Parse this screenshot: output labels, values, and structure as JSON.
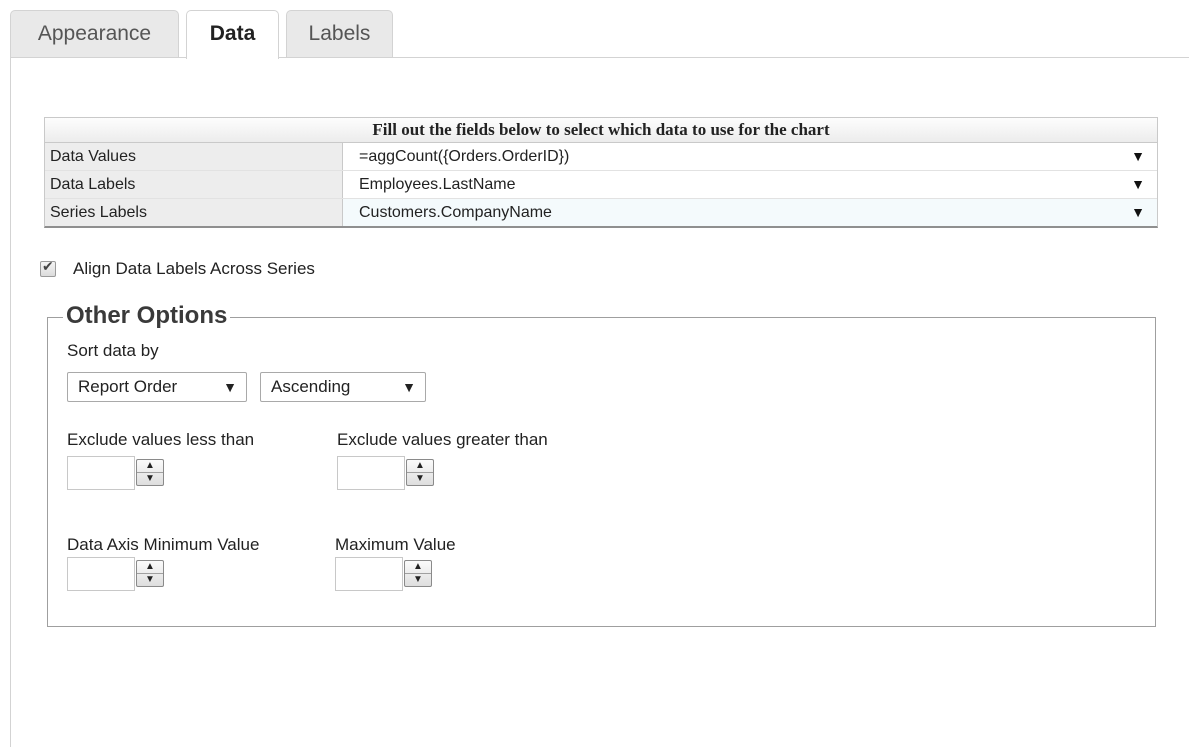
{
  "tabs": [
    {
      "label": "Appearance"
    },
    {
      "label": "Data"
    },
    {
      "label": "Labels"
    }
  ],
  "grid": {
    "header": "Fill out the fields below to select which data to use for the chart",
    "rows": [
      {
        "label": "Data Values",
        "value": "=aggCount({Orders.OrderID})"
      },
      {
        "label": "Data Labels",
        "value": "Employees.LastName"
      },
      {
        "label": "Series Labels",
        "value": "Customers.CompanyName"
      }
    ],
    "dropdown_icon": "▼"
  },
  "align_checkbox": {
    "label": "Align Data Labels Across Series",
    "checked": true,
    "tick": "✔"
  },
  "other_options": {
    "legend": "Other Options",
    "sort_label": "Sort data by",
    "sort_field": "Report Order",
    "sort_direction": "Ascending",
    "select_arrow": "▼",
    "exclude_less_label": "Exclude values less than",
    "exclude_greater_label": "Exclude values greater than",
    "axis_min_label": "Data Axis Minimum Value",
    "axis_max_label": "Maximum Value",
    "spin_up": "▲",
    "spin_down": "▼",
    "exclude_less_value": "",
    "exclude_greater_value": "",
    "axis_min_value": "",
    "axis_max_value": ""
  }
}
